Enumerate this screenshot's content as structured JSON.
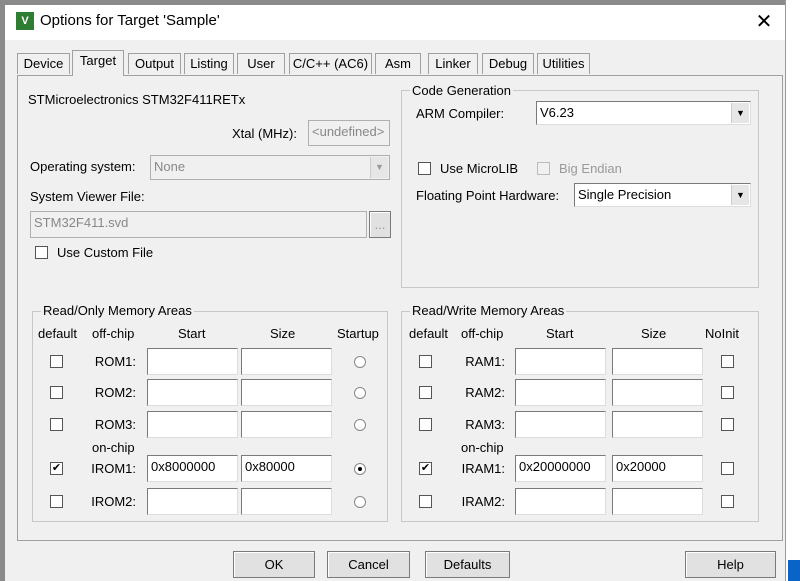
{
  "window": {
    "title": "Options for Target 'Sample'",
    "close": "✕",
    "app_icon": "V"
  },
  "tabs": [
    "Device",
    "Target",
    "Output",
    "Listing",
    "User",
    "C/C++ (AC6)",
    "Asm",
    "Linker",
    "Debug",
    "Utilities"
  ],
  "active_tab": "Target",
  "device": "STMicroelectronics STM32F411RETx",
  "xtal": {
    "label": "Xtal (MHz):",
    "value": "<undefined>"
  },
  "os": {
    "label": "Operating system:",
    "value": "None"
  },
  "svf": {
    "label": "System Viewer File:",
    "value": "STM32F411.svd",
    "browse": "...",
    "custom_label": "Use Custom File",
    "custom_checked": false
  },
  "codegen": {
    "title": "Code Generation",
    "compiler_label": "ARM Compiler:",
    "compiler": "V6.23",
    "microlib": "Use MicroLIB",
    "bigendian": "Big Endian",
    "fpu_label": "Floating Point Hardware:",
    "fpu": "Single Precision"
  },
  "ro": {
    "title": "Read/Only Memory Areas",
    "headers": {
      "default": "default",
      "offchip": "off-chip",
      "start": "Start",
      "size": "Size",
      "last": "Startup"
    },
    "onchip": "on-chip",
    "rows": [
      {
        "name": "ROM1:",
        "start": "",
        "size": "",
        "checked": false,
        "selected": false
      },
      {
        "name": "ROM2:",
        "start": "",
        "size": "",
        "checked": false,
        "selected": false
      },
      {
        "name": "ROM3:",
        "start": "",
        "size": "",
        "checked": false,
        "selected": false
      },
      {
        "name": "IROM1:",
        "start": "0x8000000",
        "size": "0x80000",
        "checked": true,
        "selected": true
      },
      {
        "name": "IROM2:",
        "start": "",
        "size": "",
        "checked": false,
        "selected": false
      }
    ]
  },
  "rw": {
    "title": "Read/Write Memory Areas",
    "headers": {
      "default": "default",
      "offchip": "off-chip",
      "start": "Start",
      "size": "Size",
      "last": "NoInit"
    },
    "onchip": "on-chip",
    "rows": [
      {
        "name": "RAM1:",
        "start": "",
        "size": "",
        "checked": false,
        "noinit": false
      },
      {
        "name": "RAM2:",
        "start": "",
        "size": "",
        "checked": false,
        "noinit": false
      },
      {
        "name": "RAM3:",
        "start": "",
        "size": "",
        "checked": false,
        "noinit": false
      },
      {
        "name": "IRAM1:",
        "start": "0x20000000",
        "size": "0x20000",
        "checked": true,
        "noinit": false
      },
      {
        "name": "IRAM2:",
        "start": "",
        "size": "",
        "checked": false,
        "noinit": false
      }
    ]
  },
  "buttons": {
    "ok": "OK",
    "cancel": "Cancel",
    "defaults": "Defaults",
    "help": "Help"
  }
}
